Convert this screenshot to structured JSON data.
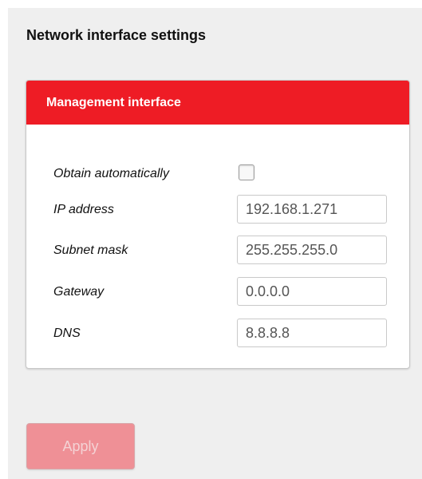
{
  "page": {
    "title": "Network interface settings"
  },
  "panel": {
    "title": "Management interface",
    "fields": {
      "obtain_automatically": {
        "label": "Obtain automatically",
        "checked": false
      },
      "ip_address": {
        "label": "IP address",
        "value": "192.168.1.271"
      },
      "subnet_mask": {
        "label": "Subnet mask",
        "value": "255.255.255.0"
      },
      "gateway": {
        "label": "Gateway",
        "value": "0.0.0.0"
      },
      "dns": {
        "label": "DNS",
        "value": "8.8.8.8"
      }
    }
  },
  "actions": {
    "apply_label": "Apply",
    "apply_disabled": true
  },
  "colors": {
    "accent": "#ee1c25",
    "apply_disabled_bg": "#ef9096",
    "page_bg": "#efefef"
  }
}
